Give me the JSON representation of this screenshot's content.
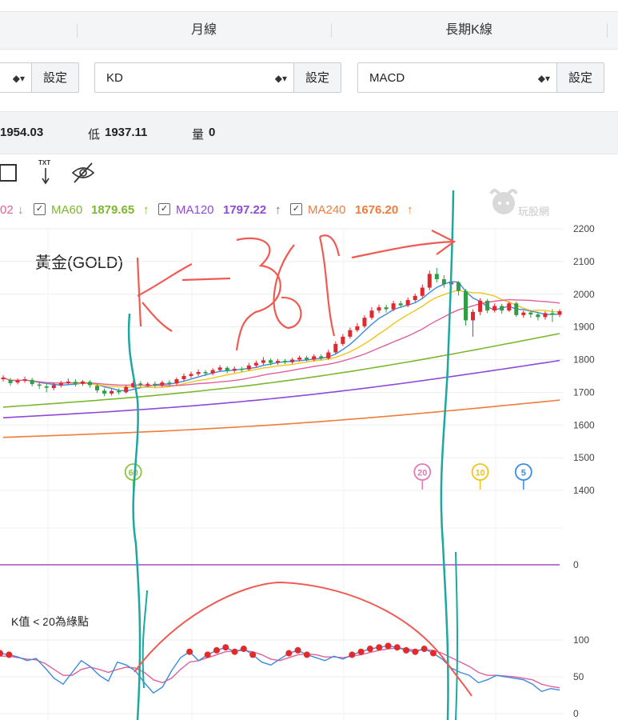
{
  "tabs": {
    "monthly": "月線",
    "long_term": "長期K線"
  },
  "selectors": {
    "first_button": "設定",
    "kd_value": "KD",
    "kd_button": "設定",
    "macd_value": "MACD",
    "macd_button": "設定",
    "arrow_glyph": "◆▾"
  },
  "info": {
    "high_value": "1954.03",
    "low_label": "低",
    "low_value": "1937.11",
    "volume_label": "量",
    "volume_value": "0"
  },
  "tools": {
    "txt_label": "TXT"
  },
  "ma_legend": {
    "partial_value": "02",
    "partial_trend": "↓",
    "items": [
      {
        "name": "MA60",
        "value": "1879.65",
        "trend": "↑",
        "color": "#7cb82f"
      },
      {
        "name": "MA120",
        "value": "1797.22",
        "trend": "↑",
        "color": "#8e4ad6"
      },
      {
        "name": "MA240",
        "value": "1676.20",
        "trend": "↑",
        "color": "#f07c3c"
      }
    ],
    "check_glyph": "✓"
  },
  "watermark": "玩股網",
  "chart_title": "黃金(GOLD)",
  "k_note": "K值 < 20為綠點",
  "chart_data": {
    "type": "line",
    "title": "黃金(GOLD)",
    "price_axis": {
      "ticks": [
        2200,
        2100,
        2000,
        1900,
        1800,
        1700,
        1600,
        1500,
        1400
      ],
      "ylim": [
        1400,
        2200
      ]
    },
    "macd_axis": {
      "ticks": [
        0
      ]
    },
    "kd_axis": {
      "ticks": [
        100,
        50,
        0
      ],
      "ylim": [
        0,
        100
      ]
    },
    "period_markers": [
      {
        "label": "60",
        "color": "#8cc63f"
      },
      {
        "label": "20",
        "color": "#e07bb5"
      },
      {
        "label": "10",
        "color": "#f0c419"
      },
      {
        "label": "5",
        "color": "#3b8be0"
      }
    ],
    "candles": [
      {
        "o": 1740,
        "c": 1745,
        "h": 1752,
        "l": 1733
      },
      {
        "o": 1738,
        "c": 1728,
        "h": 1744,
        "l": 1720
      },
      {
        "o": 1730,
        "c": 1736,
        "h": 1742,
        "l": 1724
      },
      {
        "o": 1735,
        "c": 1740,
        "h": 1748,
        "l": 1729
      },
      {
        "o": 1738,
        "c": 1725,
        "h": 1744,
        "l": 1718
      },
      {
        "o": 1724,
        "c": 1720,
        "h": 1730,
        "l": 1710
      },
      {
        "o": 1718,
        "c": 1714,
        "h": 1726,
        "l": 1700
      },
      {
        "o": 1713,
        "c": 1722,
        "h": 1730,
        "l": 1706
      },
      {
        "o": 1722,
        "c": 1728,
        "h": 1735,
        "l": 1715
      },
      {
        "o": 1728,
        "c": 1733,
        "h": 1742,
        "l": 1722
      },
      {
        "o": 1732,
        "c": 1726,
        "h": 1740,
        "l": 1718
      },
      {
        "o": 1726,
        "c": 1733,
        "h": 1738,
        "l": 1720
      },
      {
        "o": 1732,
        "c": 1722,
        "h": 1737,
        "l": 1714
      },
      {
        "o": 1720,
        "c": 1706,
        "h": 1726,
        "l": 1698
      },
      {
        "o": 1705,
        "c": 1696,
        "h": 1712,
        "l": 1688
      },
      {
        "o": 1696,
        "c": 1704,
        "h": 1710,
        "l": 1690
      },
      {
        "o": 1704,
        "c": 1700,
        "h": 1712,
        "l": 1693
      },
      {
        "o": 1700,
        "c": 1716,
        "h": 1722,
        "l": 1696
      },
      {
        "o": 1716,
        "c": 1728,
        "h": 1736,
        "l": 1712
      },
      {
        "o": 1727,
        "c": 1722,
        "h": 1734,
        "l": 1716
      },
      {
        "o": 1722,
        "c": 1726,
        "h": 1731,
        "l": 1717
      },
      {
        "o": 1726,
        "c": 1721,
        "h": 1733,
        "l": 1715
      },
      {
        "o": 1722,
        "c": 1730,
        "h": 1736,
        "l": 1716
      },
      {
        "o": 1730,
        "c": 1727,
        "h": 1737,
        "l": 1720
      },
      {
        "o": 1727,
        "c": 1740,
        "h": 1746,
        "l": 1722
      },
      {
        "o": 1740,
        "c": 1750,
        "h": 1757,
        "l": 1734
      },
      {
        "o": 1750,
        "c": 1756,
        "h": 1763,
        "l": 1744
      },
      {
        "o": 1756,
        "c": 1762,
        "h": 1770,
        "l": 1750
      },
      {
        "o": 1762,
        "c": 1758,
        "h": 1768,
        "l": 1750
      },
      {
        "o": 1758,
        "c": 1768,
        "h": 1774,
        "l": 1752
      },
      {
        "o": 1768,
        "c": 1776,
        "h": 1783,
        "l": 1762
      },
      {
        "o": 1775,
        "c": 1766,
        "h": 1780,
        "l": 1758
      },
      {
        "o": 1766,
        "c": 1772,
        "h": 1779,
        "l": 1760
      },
      {
        "o": 1772,
        "c": 1770,
        "h": 1778,
        "l": 1762
      },
      {
        "o": 1770,
        "c": 1782,
        "h": 1790,
        "l": 1766
      },
      {
        "o": 1782,
        "c": 1790,
        "h": 1797,
        "l": 1776
      },
      {
        "o": 1790,
        "c": 1798,
        "h": 1808,
        "l": 1784
      },
      {
        "o": 1798,
        "c": 1790,
        "h": 1804,
        "l": 1782
      },
      {
        "o": 1790,
        "c": 1796,
        "h": 1802,
        "l": 1784
      },
      {
        "o": 1796,
        "c": 1792,
        "h": 1802,
        "l": 1786
      },
      {
        "o": 1792,
        "c": 1800,
        "h": 1806,
        "l": 1787
      },
      {
        "o": 1800,
        "c": 1806,
        "h": 1812,
        "l": 1794
      },
      {
        "o": 1806,
        "c": 1800,
        "h": 1812,
        "l": 1794
      },
      {
        "o": 1800,
        "c": 1810,
        "h": 1816,
        "l": 1795
      },
      {
        "o": 1810,
        "c": 1804,
        "h": 1816,
        "l": 1798
      },
      {
        "o": 1804,
        "c": 1822,
        "h": 1830,
        "l": 1800
      },
      {
        "o": 1822,
        "c": 1848,
        "h": 1856,
        "l": 1818
      },
      {
        "o": 1848,
        "c": 1870,
        "h": 1878,
        "l": 1842
      },
      {
        "o": 1870,
        "c": 1890,
        "h": 1898,
        "l": 1864
      },
      {
        "o": 1890,
        "c": 1902,
        "h": 1912,
        "l": 1884
      },
      {
        "o": 1902,
        "c": 1928,
        "h": 1936,
        "l": 1896
      },
      {
        "o": 1928,
        "c": 1950,
        "h": 1960,
        "l": 1922
      },
      {
        "o": 1950,
        "c": 1960,
        "h": 1968,
        "l": 1942
      },
      {
        "o": 1960,
        "c": 1954,
        "h": 1968,
        "l": 1944
      },
      {
        "o": 1954,
        "c": 1972,
        "h": 1980,
        "l": 1948
      },
      {
        "o": 1972,
        "c": 1966,
        "h": 1980,
        "l": 1958
      },
      {
        "o": 1966,
        "c": 1982,
        "h": 1990,
        "l": 1960
      },
      {
        "o": 1982,
        "c": 1995,
        "h": 2002,
        "l": 1976
      },
      {
        "o": 1995,
        "c": 2020,
        "h": 2030,
        "l": 1988
      },
      {
        "o": 2020,
        "c": 2062,
        "h": 2072,
        "l": 2012
      },
      {
        "o": 2062,
        "c": 2046,
        "h": 2080,
        "l": 2036
      },
      {
        "o": 2046,
        "c": 2030,
        "h": 2058,
        "l": 2020
      },
      {
        "o": 2030,
        "c": 2036,
        "h": 2046,
        "l": 2022
      },
      {
        "o": 2036,
        "c": 2010,
        "h": 2040,
        "l": 1996
      },
      {
        "o": 2010,
        "c": 1920,
        "h": 2016,
        "l": 1904
      },
      {
        "o": 1920,
        "c": 1946,
        "h": 1954,
        "l": 1870
      },
      {
        "o": 1946,
        "c": 1980,
        "h": 1988,
        "l": 1936
      },
      {
        "o": 1980,
        "c": 1950,
        "h": 1986,
        "l": 1942
      },
      {
        "o": 1950,
        "c": 1964,
        "h": 1972,
        "l": 1944
      },
      {
        "o": 1964,
        "c": 1950,
        "h": 1970,
        "l": 1940
      },
      {
        "o": 1950,
        "c": 1972,
        "h": 1978,
        "l": 1946
      },
      {
        "o": 1972,
        "c": 1936,
        "h": 1978,
        "l": 1930
      },
      {
        "o": 1936,
        "c": 1944,
        "h": 1950,
        "l": 1928
      },
      {
        "o": 1944,
        "c": 1938,
        "h": 1950,
        "l": 1928
      },
      {
        "o": 1938,
        "c": 1930,
        "h": 1944,
        "l": 1920
      },
      {
        "o": 1930,
        "c": 1942,
        "h": 1948,
        "l": 1922
      },
      {
        "o": 1942,
        "c": 1937,
        "h": 1954,
        "l": 1915
      },
      {
        "o": 1937,
        "c": 1948,
        "h": 1954,
        "l": 1930
      }
    ],
    "k_series": [
      82,
      80,
      77,
      72,
      75,
      62,
      48,
      40,
      56,
      72,
      64,
      52,
      44,
      70,
      66,
      58,
      42,
      28,
      36,
      58,
      76,
      84,
      72,
      80,
      86,
      90,
      84,
      88,
      80,
      70,
      66,
      74,
      82,
      86,
      80,
      76,
      72,
      78,
      74,
      80,
      84,
      88,
      90,
      92,
      90,
      86,
      84,
      88,
      82,
      74,
      62,
      56,
      52,
      42,
      46,
      52,
      50,
      48,
      46,
      40,
      30,
      34,
      32
    ],
    "d_series": [
      78,
      78,
      76,
      74,
      73,
      68,
      60,
      52,
      52,
      60,
      63,
      60,
      56,
      60,
      63,
      62,
      56,
      46,
      42,
      48,
      60,
      70,
      72,
      76,
      80,
      84,
      85,
      86,
      84,
      80,
      74,
      72,
      76,
      80,
      81,
      80,
      77,
      77,
      76,
      78,
      80,
      83,
      86,
      88,
      89,
      88,
      86,
      87,
      86,
      82,
      76,
      70,
      64,
      56,
      52,
      52,
      51,
      50,
      48,
      46,
      40,
      37,
      35
    ]
  }
}
